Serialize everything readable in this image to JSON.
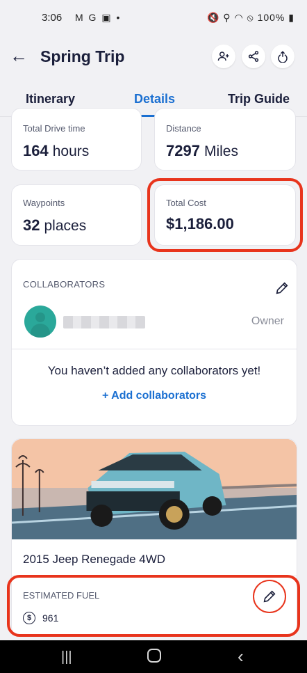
{
  "status_bar": {
    "time": "3:06",
    "left_icons": "M G ▣ •",
    "right_icons": "🔇 ⚲ ◠ ⦸",
    "battery": "100%"
  },
  "header": {
    "title": "Spring Trip",
    "actions": [
      "add-person-icon",
      "share-icon",
      "export-icon"
    ]
  },
  "tabs": [
    {
      "label": "Itinerary",
      "active": false
    },
    {
      "label": "Details",
      "active": true
    },
    {
      "label": "Trip Guide",
      "active": false
    }
  ],
  "stats": {
    "drive_time": {
      "label": "Total Drive time",
      "value": "164",
      "unit": "hours"
    },
    "distance": {
      "label": "Distance",
      "value": "7297",
      "unit": "Miles"
    },
    "waypoints": {
      "label": "Waypoints",
      "value": "32",
      "unit": "places"
    },
    "total_cost": {
      "label": "Total Cost",
      "value": "$1,186.00"
    }
  },
  "collaborators": {
    "title": "COLLABORATORS",
    "owner_role": "Owner",
    "empty_message": "You haven’t added any collaborators yet!",
    "add_label": "+ Add collaborators"
  },
  "vehicle": {
    "name": "2015 Jeep Renegade 4WD",
    "fuel_label": "ESTIMATED FUEL",
    "fuel_value": "961"
  },
  "colors": {
    "accent": "#1a6fd1",
    "highlight": "#e8341c",
    "avatar": "#2aa89a"
  }
}
